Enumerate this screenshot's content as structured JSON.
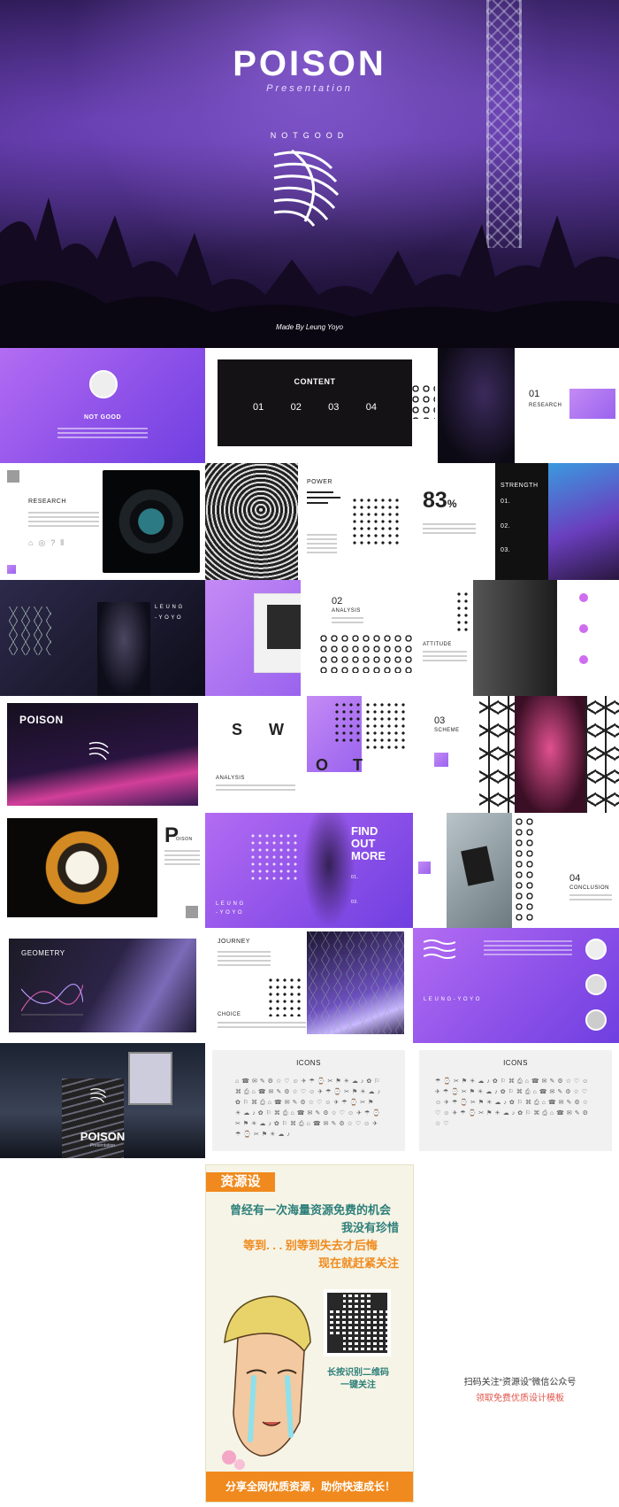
{
  "hero": {
    "title": "POISON",
    "subtitle": "Presentation",
    "brand": "NOTGOOD",
    "made_by": "Made By Leung Yoyo"
  },
  "slides": {
    "profile_brand": "NOT GOOD",
    "content_title": "CONTENT",
    "content_nums": [
      "01",
      "02",
      "03",
      "04"
    ],
    "research_num": "01",
    "research_label": "RESEARCH",
    "research_title": "RESEARCH",
    "power_title": "POWER",
    "percent_value": "83",
    "percent_sign": "%",
    "strength_title": "STRENGTH",
    "strength_nums": [
      "01.",
      "02.",
      "03."
    ],
    "leung_line1": "L E U N G",
    "leung_line2": "- Y O Y O",
    "analysis_num": "02",
    "analysis_label": "ANALYSIS",
    "attitude_label": "ATTITUDE",
    "poison_title": "POISON",
    "swot_s": "S",
    "swot_w": "W",
    "swot_o": "O",
    "swot_t": "T",
    "swot_analysis": "ANALYSIS",
    "scheme_num": "03",
    "scheme_label": "SCHEME",
    "p_letter": "P",
    "p_rest": "OISON",
    "find_out_more": [
      "FIND",
      "OUT",
      "MORE"
    ],
    "find_nums": [
      "01.",
      "03."
    ],
    "leung_bottom": "L E U N G",
    "yoyo_bottom": "- Y O Y O",
    "conclusion_num": "04",
    "conclusion_label": "CONCLUSION",
    "geometry_title": "GEOMETRY",
    "journey_title": "JOURNEY",
    "choice_title": "CHOICE",
    "leung_yoyo_band": "L E U N G  -  Y O Y O",
    "escalator_title": "POISON",
    "escalator_sub": "Presentation",
    "icons_title_1": "ICONS",
    "icons_title_2": "ICONS"
  },
  "poster": {
    "tag": "资源设",
    "line1": "曾经有一次海量资源免费的机会",
    "line2": "我没有珍惜",
    "line3": "等到. . . 别等到失去才后悔",
    "line4": "现在就赶紧关注",
    "qr_text1": "长按识别二维码",
    "qr_text2": "一键关注",
    "bottom": "分享全网优质资源，助你快速成长！"
  },
  "side_caption": {
    "line1": "扫码关注“资源设”微信公众号",
    "line2": "领取免费优质设计模板",
    "line2_color": "#e0544a"
  },
  "colors": {
    "accent_purple": "#9a5cf0",
    "accent_orange": "#f08a1e",
    "accent_teal": "#2d7f7a"
  }
}
